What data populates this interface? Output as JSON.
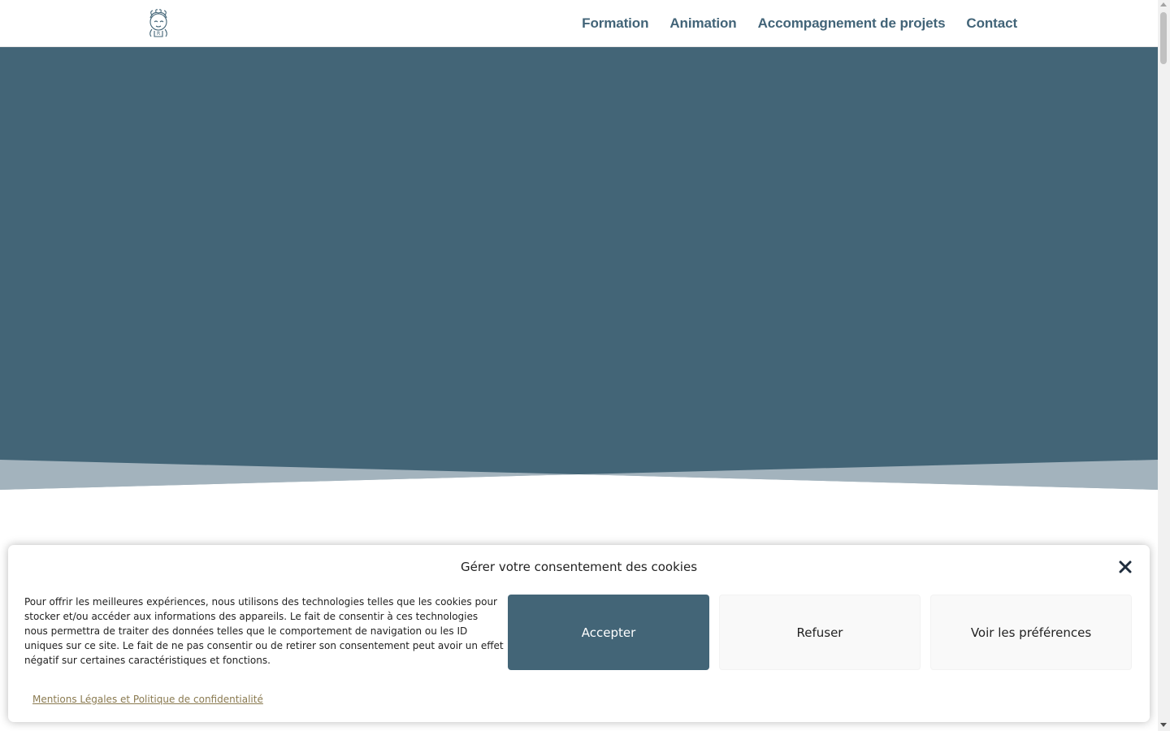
{
  "header": {
    "nav": [
      {
        "label": "Formation"
      },
      {
        "label": "Animation"
      },
      {
        "label": "Accompagnement de projets"
      },
      {
        "label": "Contact"
      }
    ]
  },
  "colors": {
    "brand": "#436577",
    "hero_wave": "#a3b3bd",
    "link": "#8a7a50"
  },
  "cookie_banner": {
    "title": "Gérer votre consentement des cookies",
    "body": "Pour offrir les meilleures expériences, nous utilisons des technologies telles que les cookies pour stocker et/ou accéder aux informations des appareils. Le fait de consentir à ces technologies nous permettra de traiter des données telles que le comportement de navigation ou les ID uniques sur ce site. Le fait de ne pas consentir ou de retirer son consentement peut avoir un effet négatif sur certaines caractéristiques et fonctions.",
    "accept_label": "Accepter",
    "refuse_label": "Refuser",
    "preferences_label": "Voir les préférences",
    "legal_link": "Mentions Légales et Politique de confidentialité",
    "close_icon": "close-icon"
  }
}
